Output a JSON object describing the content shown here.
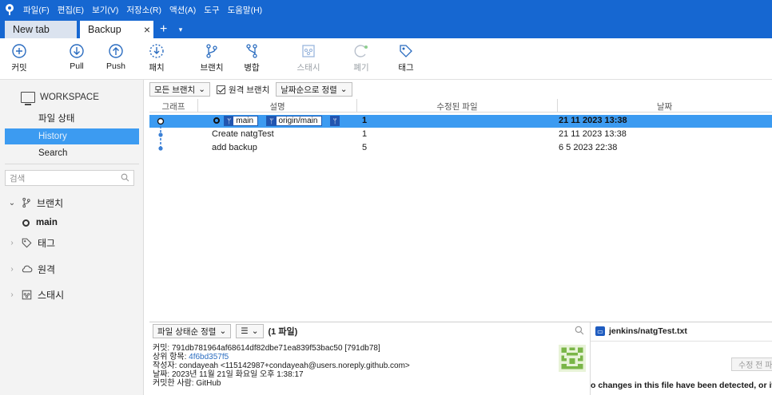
{
  "menubar": {
    "items": [
      "파일(F)",
      "편집(E)",
      "보기(V)",
      "저장소(R)",
      "액션(A)",
      "도구",
      "도움말(H)"
    ]
  },
  "tabs": {
    "inactive_label": "New tab",
    "active_label": "Backup",
    "close_glyph": "×",
    "add_glyph": "+",
    "menu_glyph": "▾"
  },
  "toolbar": {
    "commit": "커밋",
    "pull": "Pull",
    "push": "Push",
    "fetch": "패치",
    "branch": "브랜치",
    "merge": "병합",
    "stash": "스태시",
    "discard": "폐기",
    "tag": "태그"
  },
  "sidebar": {
    "workspace": "WORKSPACE",
    "file_status": "파일 상태",
    "history": "History",
    "search": "Search",
    "search_placeholder": "검색",
    "branches": "브랜치",
    "branch_main": "main",
    "tags": "태그",
    "remotes": "원격",
    "stashes": "스태시"
  },
  "filterbar": {
    "all_branches": "모든 브랜치",
    "remote_branches": "원격 브랜치",
    "sort": "날짜순으로 정렬"
  },
  "table": {
    "headers": {
      "graph": "그래프",
      "description": "설명",
      "changed_files": "수정된 파일",
      "date": "날짜"
    },
    "rows": [
      {
        "description": "",
        "branch_tag": "main",
        "remote_tag": "origin/main",
        "files": "1",
        "date": "21 11 2023 13:38"
      },
      {
        "description": "Create natgTest",
        "files": "1",
        "date": "21 11 2023 13:38"
      },
      {
        "description": "add backup",
        "files": "5",
        "date": "6 5 2023 22:38"
      }
    ]
  },
  "bottom": {
    "sort_label": "파일 상태순 정렬",
    "view_glyph": "☰",
    "file_count": "(1 파일)",
    "commit_line": "커밋: 791db781964af68614df82dbe71ea839f53bac50 [791db78]",
    "parent_label": "상위 항목: ",
    "parent_hash": "4f6bd357f5",
    "author_line": "작성자: condayeah <115142987+condayeah@users.noreply.github.com>",
    "date_line": "날짜: 2023년 11월 21일 화요일 오후 1:38:17",
    "committer_line": "커밋한 사람: GitHub"
  },
  "right_pane": {
    "file_path": "jenkins/natgTest.txt",
    "before_button": "수정 전 파일",
    "message": "o changes in this file have been detected, or it is a binary file"
  },
  "colors": {
    "menubar_blue": "#1667d1",
    "selection_blue": "#3c9bf1",
    "tag_blue": "#2255b0",
    "graph_blue": "#3a7fd5"
  }
}
